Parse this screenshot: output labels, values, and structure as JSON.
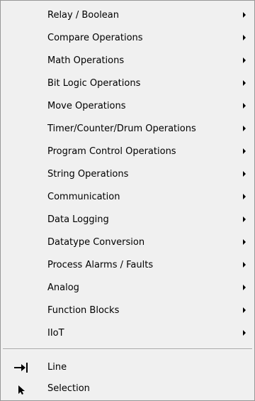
{
  "menu": {
    "items": [
      {
        "label": "Relay / Boolean",
        "has_submenu": true
      },
      {
        "label": "Compare Operations",
        "has_submenu": true
      },
      {
        "label": "Math Operations",
        "has_submenu": true
      },
      {
        "label": "Bit Logic Operations",
        "has_submenu": true
      },
      {
        "label": "Move Operations",
        "has_submenu": true
      },
      {
        "label": "Timer/Counter/Drum Operations",
        "has_submenu": true
      },
      {
        "label": "Program Control Operations",
        "has_submenu": true
      },
      {
        "label": "String Operations",
        "has_submenu": true
      },
      {
        "label": "Communication",
        "has_submenu": true
      },
      {
        "label": "Data Logging",
        "has_submenu": true
      },
      {
        "label": "Datatype Conversion",
        "has_submenu": true
      },
      {
        "label": "Process Alarms / Faults",
        "has_submenu": true
      },
      {
        "label": "Analog",
        "has_submenu": true
      },
      {
        "label": "Function Blocks",
        "has_submenu": true
      },
      {
        "label": "IIoT",
        "has_submenu": true
      }
    ],
    "tools": [
      {
        "label": "Line",
        "icon": "line-tool-icon"
      },
      {
        "label": "Selection",
        "icon": "selection-cursor-icon"
      }
    ],
    "submenu_arrow_icon": "submenu-arrow-icon",
    "colors": {
      "background": "#f0f0f0",
      "border": "#979797",
      "text": "#000000",
      "separator": "#a0a0a0"
    }
  }
}
